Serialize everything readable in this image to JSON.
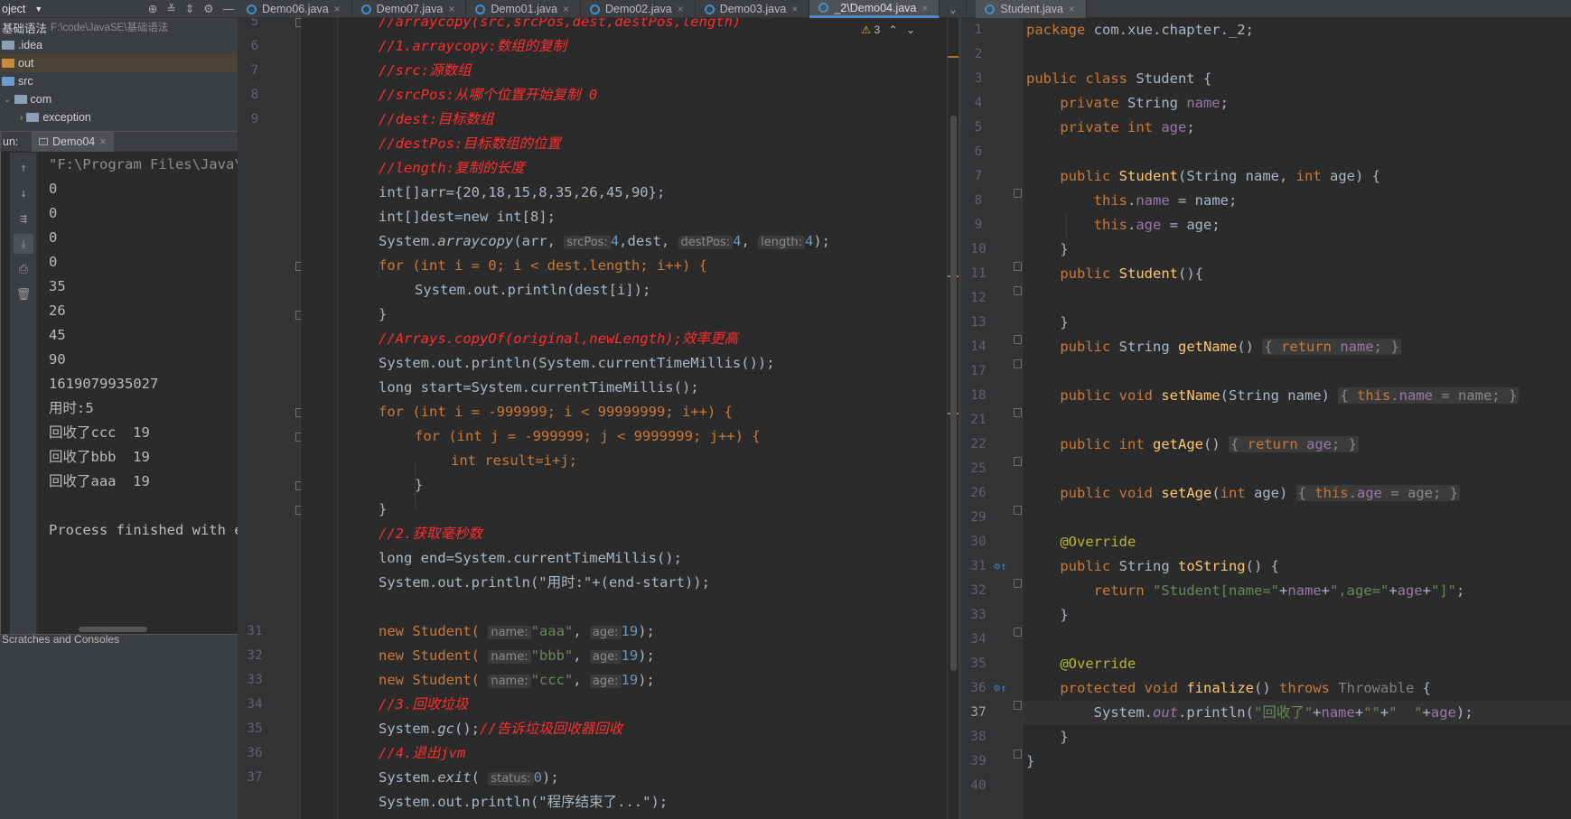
{
  "project": {
    "header": "oject",
    "root_name": "基础语法",
    "root_path": "F:\\code\\JavaSE\\基础语法",
    "items": [
      {
        "label": ".idea"
      },
      {
        "label": "out"
      },
      {
        "label": "src"
      },
      {
        "label": "com"
      },
      {
        "label": "exception"
      }
    ],
    "scratches": "Scratches and Consoles"
  },
  "run": {
    "label": "un:",
    "tab": "Demo04",
    "lines": [
      "\"F:\\Program Files\\Java\\jd",
      "0",
      "0",
      "0",
      "0",
      "35",
      "26",
      "45",
      "90",
      "1619079935027",
      "用时:5",
      "回收了ccc  19",
      "回收了bbb  19",
      "回收了aaa  19",
      "",
      "Process finished with exi"
    ]
  },
  "tabs": [
    {
      "label": "Demo06.java"
    },
    {
      "label": "Demo07.java"
    },
    {
      "label": "Demo01.java"
    },
    {
      "label": "Demo02.java"
    },
    {
      "label": "Demo03.java"
    },
    {
      "label": "_2\\Demo04.java"
    },
    {
      "label": "Student.java"
    }
  ],
  "editor_mid": {
    "warnings": "3",
    "line_numbers": [
      "5",
      "6",
      "7",
      "8",
      "9",
      "",
      "",
      "",
      "",
      "",
      "",
      "",
      "",
      "",
      "",
      "",
      "",
      "",
      "",
      "",
      "",
      "",
      "",
      "",
      "",
      "",
      "",
      "31",
      "32",
      "33",
      "34",
      "35",
      "36",
      "37"
    ],
    "c": {
      "l5": "//arraycopy(src,srcPos,dest,destPos,length)",
      "l6": "//1.arraycopy:数组的复制",
      "l7": "//src:源数组",
      "l8": "//srcPos:从哪个位置开始复制 0",
      "l9": "//dest:目标数组",
      "l10": "//destPos:目标数组的位置",
      "l11": "//length:复制的长度",
      "l12": "int[]arr={20,18,15,8,35,26,45,90};",
      "l13": "int[]dest=new int[8];",
      "l14a": "System.",
      "l14b": "arraycopy",
      "l14c": "(arr,",
      "l14h1": "srcPos:",
      "l14d": "4",
      "l14e": ",dest,",
      "l14h2": "destPos:",
      "l14f": "4",
      "l14g": ",",
      "l14h3": "length:",
      "l14i": "4",
      "l14j": ");",
      "l15": "for (int i = 0; i < dest.length; i++) {",
      "l16": "System.out.println(dest[i]);",
      "l17": "}",
      "l18": "//Arrays.copyOf(original,newLength);效率更高",
      "l19": "System.out.println(System.currentTimeMillis());",
      "l20": "long start=System.currentTimeMillis();",
      "l21": "for (int i = -999999; i < 99999999; i++) {",
      "l22": "for (int j = -999999; j < 9999999; j++) {",
      "l23": "int result=i+j;",
      "l24": "}",
      "l25": "}",
      "l26": "//2.获取毫秒数",
      "l27": "long end=System.currentTimeMillis();",
      "l28": "System.out.println(\"用时:\"+(end-start));",
      "l30a": "new Student(",
      "l30h1": "name:",
      "l30s1": "\"aaa\"",
      "l30h2": "age:",
      "l30n": "19",
      "l31s1": "\"bbb\"",
      "l32s1": "\"ccc\"",
      "l33": "//3.回收垃圾",
      "l34a": "System.",
      "l34b": "gc",
      "l34c": "();",
      "l34d": "//告诉垃圾回收器回收",
      "l35": "//4.退出jvm",
      "l36a": "System.",
      "l36b": "exit",
      "l36c": "(",
      "l36h": "status:",
      "l36d": "0",
      "l36e": ");",
      "l37": "System.out.println(\"程序结束了...\");"
    }
  },
  "editor_right": {
    "line_numbers": [
      "1",
      "2",
      "3",
      "4",
      "5",
      "6",
      "7",
      "8",
      "9",
      "10",
      "11",
      "12",
      "13",
      "14",
      "17",
      "18",
      "21",
      "22",
      "25",
      "26",
      "29",
      "30",
      "31",
      "32",
      "33",
      "34",
      "35",
      "36",
      "37",
      "38",
      "39",
      "40"
    ]
  },
  "colors": {
    "background": "#2b2b2b",
    "keyword": "#cc7832",
    "comment": "#ff2d2d",
    "number": "#6897bb",
    "string": "#6a8759",
    "method": "#ffc66d",
    "field": "#9876aa",
    "annotation": "#bbb529",
    "active_tab_underline": "#4a88c7"
  }
}
